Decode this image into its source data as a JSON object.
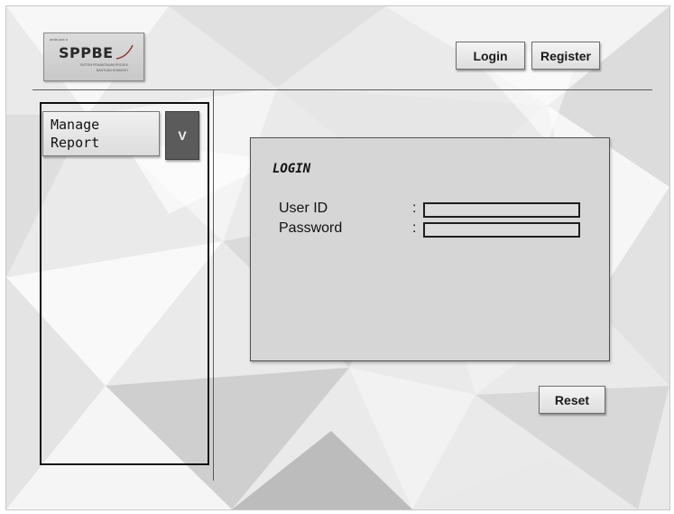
{
  "header": {
    "logo": {
      "tagline": "anda yoa a",
      "wordmark": "SPPBE",
      "subtitle_line1": "SISTEM PEMANTAUAN PROJEK",
      "subtitle_line2": "BANTUAN KOMUNITI"
    },
    "login_label": "Login",
    "register_label": "Register"
  },
  "sidebar": {
    "menu_label": "Manage\nReport",
    "toggle_label": "V"
  },
  "login_panel": {
    "title": "LOGIN",
    "user_id_label": "User ID",
    "password_label": "Password",
    "separator": ":",
    "user_id_value": "",
    "password_value": ""
  },
  "reset_label": "Reset",
  "colors": {
    "panel_bg": "#d6d6d6",
    "toggle_bg": "#5b5b5b",
    "border_dark": "#111111"
  }
}
